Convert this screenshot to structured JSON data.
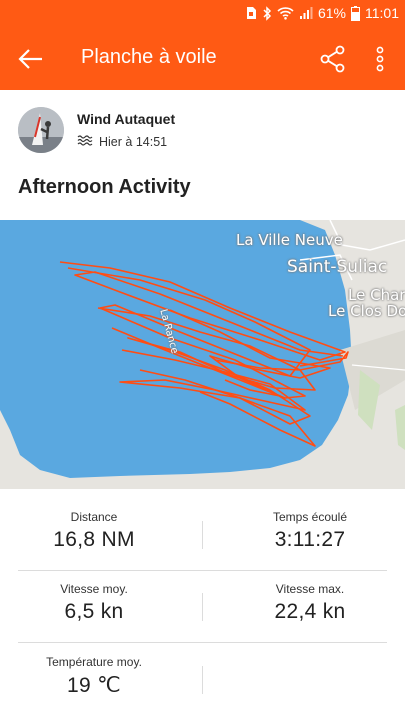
{
  "status_bar": {
    "battery_percent": "61%",
    "time": "11:01",
    "icons": [
      "sim-icon",
      "bluetooth-icon",
      "wifi-icon",
      "signal-icon",
      "battery-icon"
    ]
  },
  "app_bar": {
    "title": "Planche à voile",
    "back_icon": "back-arrow-icon",
    "share_icon": "share-icon",
    "more_icon": "more-vert-icon"
  },
  "athlete": {
    "name": "Wind Autaquet",
    "time": "Hier à 14:51",
    "sport_icon": "windsurf-waves-icon"
  },
  "activity": {
    "title": "Afternoon Activity"
  },
  "map": {
    "labels": [
      "La Ville Neuve",
      "Saint-Suliac",
      "Le Char",
      "Le Clos Do",
      "La Rance"
    ],
    "water_color": "#5aa8e0",
    "land_color": "#e6e4df",
    "track_color": "#ff4d14"
  },
  "stats": [
    {
      "label": "Distance",
      "value": "16,8 NM"
    },
    {
      "label": "Temps écoulé",
      "value": "3:11:27"
    },
    {
      "label": "Vitesse moy.",
      "value": "6,5 kn"
    },
    {
      "label": "Vitesse max.",
      "value": "22,4 kn"
    },
    {
      "label": "Température moy.",
      "value": "19 ℃"
    }
  ],
  "colors": {
    "brand": "#ff5a14"
  }
}
